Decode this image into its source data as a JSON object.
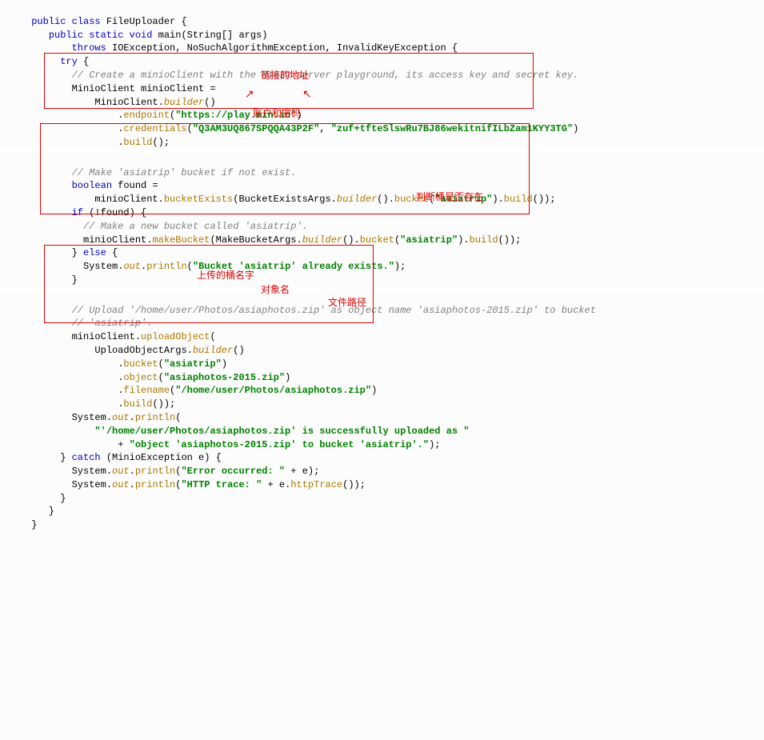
{
  "code": {
    "class_decl_kw": "public class",
    "class_name": " FileUploader {",
    "main_kw": "public static void",
    "main_sig": " main(String[] args)",
    "throws_kw": "throws",
    "throws_list": " IOException, NoSuchAlgorithmException, InvalidKeyException {",
    "try_kw": "try",
    "c1": "// Create a minioClient with the MinIO server playground, its access key and secret key.",
    "l_minioclient_decl": "MinioClient minioClient =",
    "l_builder_cls": "MinioClient.",
    "m_builder": "builder",
    "m_endpoint": "endpoint",
    "s_endpoint": "\"https://play.min.io\"",
    "m_credentials": "credentials",
    "s_access": "\"Q3AM3UQ867SPQQA43P2F\"",
    "s_secret": "\"zuf+tfteSlswRu7BJ86wekitnifILbZam1KYY3TG\"",
    "m_build": "build",
    "c2": "// Make 'asiatrip' bucket if not exist.",
    "boolean_kw": "boolean",
    "found_eq": " found =",
    "m_bucketExists": "bucketExists",
    "bea_cls": "BucketExistsArgs.",
    "m_bucket": "bucket",
    "s_asiatrip": "\"asiatrip\"",
    "if_kw": "if",
    "if_cond": " (!found) {",
    "c3": "// Make a new bucket called 'asiatrip'.",
    "m_makeBucket": "makeBucket",
    "mba_cls": "MakeBucketArgs.",
    "else_kw": "else",
    "sysout": "System.",
    "out_fld": "out",
    "m_println": "println",
    "s_already": "\"Bucket 'asiatrip' already exists.\"",
    "c4a": "// Upload '/home/user/Photos/asiaphotos.zip' as object name 'asiaphotos-2015.zip' to bucket",
    "c4b": "// 'asiatrip'.",
    "m_uploadObject": "uploadObject",
    "uoa_cls": "UploadObjectArgs.",
    "m_object": "object",
    "s_obj": "\"asiaphotos-2015.zip\"",
    "m_filename": "filename",
    "s_file": "\"/home/user/Photos/asiaphotos.zip\"",
    "s_up1": "\"'/home/user/Photos/asiaphotos.zip' is successfully uploaded as \"",
    "s_up2": "\"object 'asiaphotos-2015.zip' to bucket 'asiatrip'.\"",
    "catch_kw": "catch",
    "catch_sig": " (MinioException e) {",
    "s_err": "\"Error occurred: \"",
    "s_http": "\"HTTP trace: \"",
    "m_httpTrace": "httpTrace"
  },
  "annotations": {
    "a1": "链接的地址",
    "a2": "账户和密码",
    "a3": "判断桶是否存在",
    "a4": "上传的桶名字",
    "a5": "对象名",
    "a6": "文件路径"
  }
}
